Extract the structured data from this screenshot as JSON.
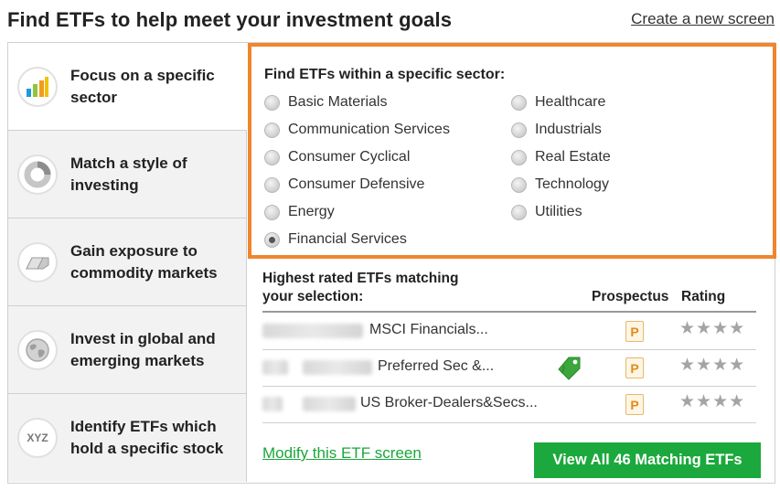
{
  "header": {
    "title": "Find ETFs to help meet your investment goals",
    "create_link": "Create a new screen"
  },
  "sidebar": {
    "items": [
      {
        "label": "Focus on a specific sector",
        "icon": "bar-chart-icon",
        "active": true
      },
      {
        "label": "Match a style of investing",
        "icon": "style-ring-icon",
        "active": false
      },
      {
        "label": "Gain exposure to commodity markets",
        "icon": "gold-bar-icon",
        "active": false
      },
      {
        "label": "Invest in global and emerging markets",
        "icon": "globe-icon",
        "active": false
      },
      {
        "label": "Identify ETFs which hold a specific stock",
        "icon": "xyz-icon",
        "icon_text": "XYZ",
        "active": false
      }
    ]
  },
  "sector": {
    "heading": "Find ETFs within a specific sector:",
    "options_left": [
      "Basic Materials",
      "Communication Services",
      "Consumer Cyclical",
      "Consumer Defensive",
      "Energy",
      "Financial Services"
    ],
    "options_right": [
      "Healthcare",
      "Industrials",
      "Real Estate",
      "Technology",
      "Utilities"
    ],
    "selected": "Financial Services"
  },
  "results": {
    "heading": "Highest rated ETFs matching your selection:",
    "col_prospectus": "Prospectus",
    "col_rating": "Rating",
    "rows": [
      {
        "name": "MSCI Financials...",
        "prospectus": "P",
        "stars": "★★★★",
        "rating": 4,
        "tag": false
      },
      {
        "name": "Preferred Sec &...",
        "prospectus": "P",
        "stars": "★★★★",
        "rating": 4,
        "tag": true
      },
      {
        "name": "US Broker-Dealers&Secs...",
        "prospectus": "P",
        "stars": "★★★★",
        "rating": 4,
        "tag": false
      }
    ],
    "modify_link": "Modify this ETF screen",
    "view_all": "View All 46 Matching ETFs"
  },
  "colors": {
    "accent_orange": "#f0852d",
    "green": "#1ba83c",
    "prospectus_orange": "#e08d1a",
    "star_gray": "#a4a4a4"
  }
}
